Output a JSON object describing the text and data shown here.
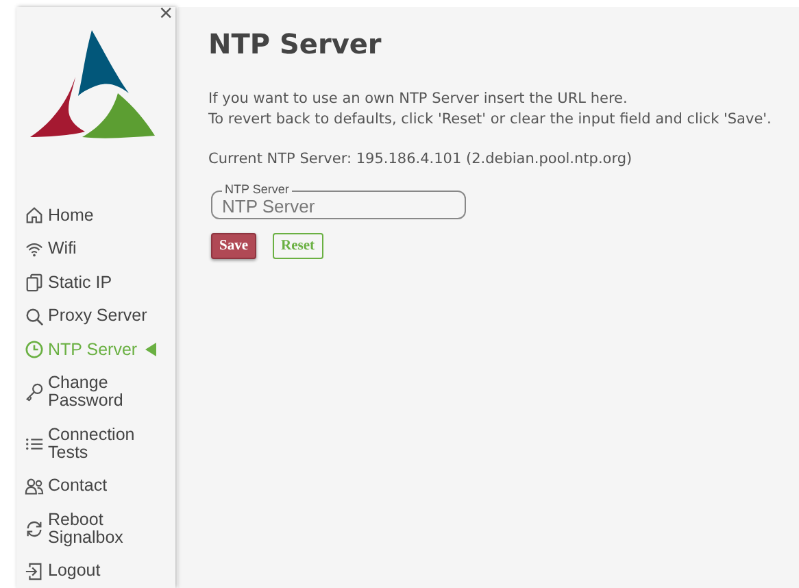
{
  "sidebar": {
    "close": "×",
    "items": [
      {
        "label": "Home",
        "selected": false
      },
      {
        "label": "Wifi",
        "selected": false
      },
      {
        "label": "Static IP",
        "selected": false
      },
      {
        "label": "Proxy Server",
        "selected": false
      },
      {
        "label": "NTP Server",
        "selected": true
      },
      {
        "label": "Change Password",
        "selected": false
      },
      {
        "label": "Connection Tests",
        "selected": false
      },
      {
        "label": "Contact",
        "selected": false
      },
      {
        "label": "Reboot Signalbox",
        "selected": false
      },
      {
        "label": "Logout",
        "selected": false
      }
    ]
  },
  "main": {
    "title": "NTP Server",
    "intro": [
      "If you want to use an own NTP Server insert the URL here.",
      "To revert back to defaults, click 'Reset' or clear the input field and click 'Save'."
    ],
    "current": "Current NTP Server: 195.186.4.101 (2.debian.pool.ntp.org)",
    "field": {
      "label": "NTP Server",
      "placeholder": "NTP Server"
    },
    "buttons": [
      {
        "label": "Save",
        "kind": "primary"
      },
      {
        "label": "Reset",
        "kind": "secondary"
      }
    ]
  }
}
